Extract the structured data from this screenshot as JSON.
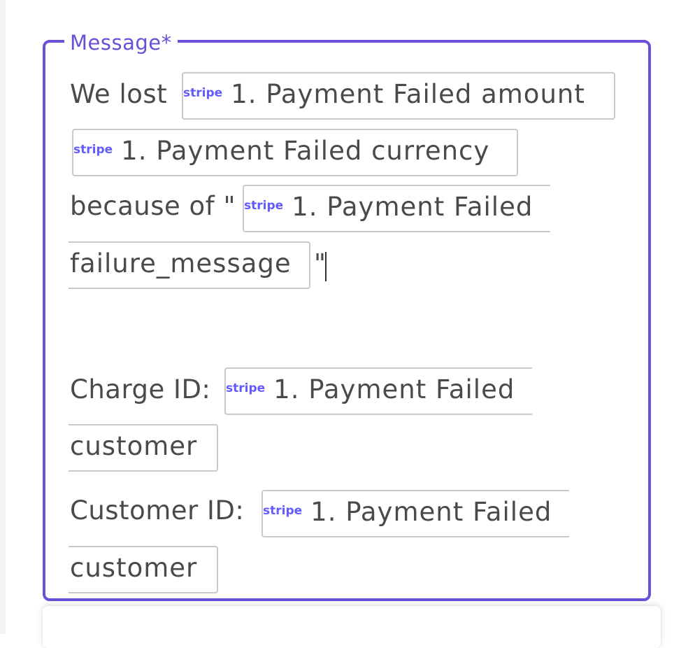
{
  "field": {
    "label": "Message*"
  },
  "message": {
    "line1_text": "We lost",
    "token_amount": "1. Payment Failed amount",
    "token_currency": "1. Payment Failed currency",
    "because_text": "because of \"",
    "token_failure_part1": "1. Payment Failed",
    "token_failure_part2": "failure_message",
    "closing_quote": "\"",
    "charge_label": "Charge ID:",
    "token_charge_part1": "1. Payment Failed",
    "token_charge_part2": "customer",
    "customer_label": "Customer ID:",
    "token_customer_part1": "1. Payment Failed",
    "token_customer_part2": "customer"
  },
  "icons": {
    "source_logo": "stripe"
  },
  "colors": {
    "accent": "#6b4fd8",
    "stripe_brand": "#635bff",
    "text": "#4a4a4a",
    "pill_border": "#c9c9c9"
  }
}
